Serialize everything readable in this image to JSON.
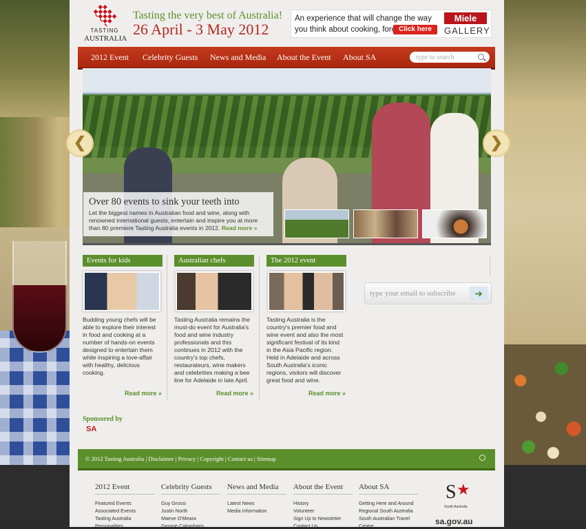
{
  "header": {
    "logo_line1": "TASTING",
    "logo_line2": "AUSTRALIA",
    "tagline": "Tasting the very best of Australia!",
    "dates": "26 April - 3 May 2012"
  },
  "ad": {
    "text": "An experience that will change the way you think about cooking, forever.",
    "button": "Click here",
    "brand": "Miele",
    "brand_sub": "GALLERY"
  },
  "nav": {
    "items": [
      "2012 Event",
      "Celebrity Guests",
      "News and Media",
      "About the Event",
      "About SA"
    ],
    "search_placeholder": "type to search"
  },
  "hero": {
    "heading": "Over 80 events to sink your teeth into",
    "body": "Let the biggest names in Australian food and wine, along with renowned international guests, entertain and inspire you at more than 80 premiere Tasting Australia events in 2012.",
    "read_more": "Read more »",
    "prev": "❮",
    "next": "❯"
  },
  "columns": [
    {
      "title": "Events for kids",
      "text": "Budding young chefs will be able to explore their interest in food and cooking at a number of hands-on events designed to entertain them while inspiring a love-affair with healthy, delicious cooking.",
      "more": "Read more »"
    },
    {
      "title": "Australian chefs",
      "text": "Tasting Australia remains the must-do event for Australia's food and wine industry professionals and this continues in 2012 with the country's top chefs, restaurateurs, wine makers and celebrities making a bee line for Adelaide in late April.",
      "more": "Read more »"
    },
    {
      "title": "The 2012 event",
      "text": "Tasting Australia is the country's premier food and wine event and also the most significant festival of its kind in the Asia Pacific region. Held in Adelaide and across South Australia's iconic regions, visitors will discover great food and wine.",
      "more": "Read more »"
    }
  ],
  "subscribe": {
    "placeholder": "type your email to subscribe"
  },
  "sponsor": {
    "label": "Sponsored by",
    "logo_text": "SA"
  },
  "footer_bar": {
    "links": "© 2012 Tasting Australia | Disclaimer | Privacy | Copyright | Contact us | Sitemap"
  },
  "footer_cols": [
    {
      "title": "2012 Event",
      "items": [
        "Featured Events",
        "Associated Events",
        "Tasting Australia",
        "Personalities"
      ]
    },
    {
      "title": "Celebrity Guests",
      "items": [
        "Guy Grossi",
        "Justin North",
        "Maeve O'Meara",
        "George Calombaris"
      ]
    },
    {
      "title": "News and Media",
      "items": [
        "Latest News",
        "Media Information"
      ]
    },
    {
      "title": "About the Event",
      "items": [
        "History",
        "Volunteer",
        "Sign Up to Newsletter",
        "Contact Us"
      ]
    },
    {
      "title": "About SA",
      "items": [
        "Getting Here and Around",
        "Regional South Australia",
        "South Australian Travel",
        "Centre"
      ]
    }
  ],
  "sa_logo": {
    "letter": "S",
    "sub": "South Australia",
    "gov": "sa.gov.au"
  },
  "colors": {
    "green": "#5b8f2b",
    "red_nav": "#b3261e",
    "date_red": "#b3261e"
  }
}
